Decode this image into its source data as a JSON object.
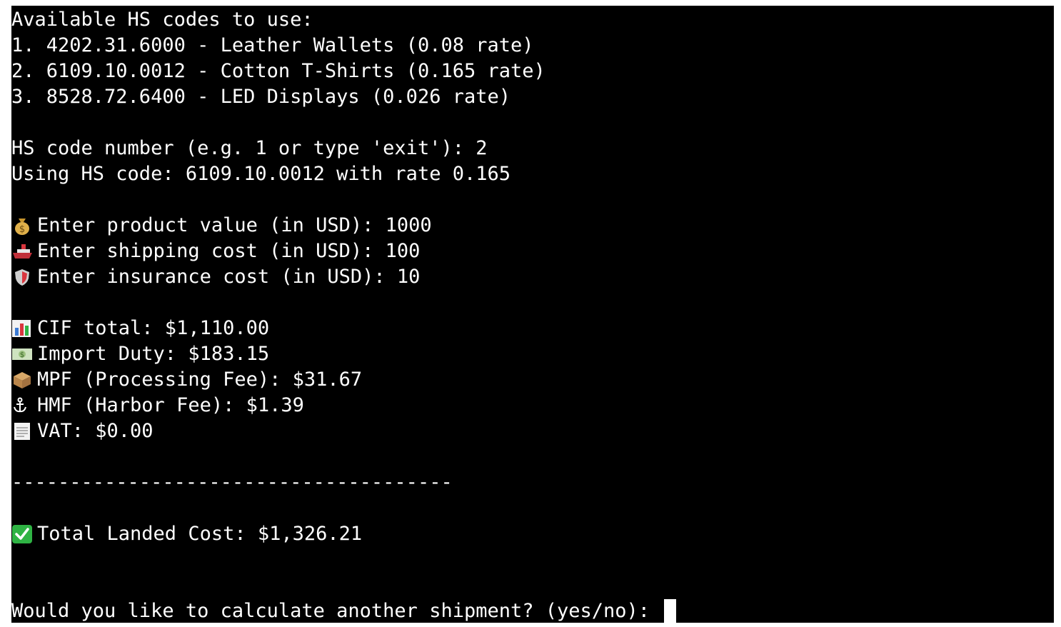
{
  "terminal": {
    "codes_header": "Available HS codes to use:",
    "codes": [
      "1. 4202.31.6000 - Leather Wallets (0.08 rate)",
      "2. 6109.10.0012 - Cotton T-Shirts (0.165 rate)",
      "3. 8528.72.6400 - LED Displays (0.026 rate)"
    ],
    "hs_prompt": "HS code number (e.g. 1 or type 'exit'): 2",
    "using_line": "Using HS code: 6109.10.0012 with rate 0.165",
    "inputs": [
      {
        "icon": "money-bag-icon",
        "text": "Enter product value (in USD): 1000"
      },
      {
        "icon": "ship-icon",
        "text": "Enter shipping cost (in USD): 100"
      },
      {
        "icon": "shield-icon",
        "text": "Enter insurance cost (in USD): 10"
      }
    ],
    "results": [
      {
        "icon": "bar-chart-icon",
        "text": "CIF total: $1,110.00"
      },
      {
        "icon": "dollar-bill-icon",
        "text": "Import Duty: $183.15"
      },
      {
        "icon": "package-icon",
        "text": "MPF (Processing Fee): $31.67"
      },
      {
        "icon": "anchor-icon",
        "text": "HMF (Harbor Fee): $1.39"
      },
      {
        "icon": "receipt-icon",
        "text": "VAT: $0.00"
      }
    ],
    "separator": "--------------------------------------",
    "total": {
      "icon": "check-mark-icon",
      "text": "Total Landed Cost: $1,326.21"
    },
    "final_prompt": "Would you like to calculate another shipment? (yes/no): "
  },
  "colors": {
    "background": "#000000",
    "foreground": "#ffffff",
    "check_green": "#2fb344"
  }
}
